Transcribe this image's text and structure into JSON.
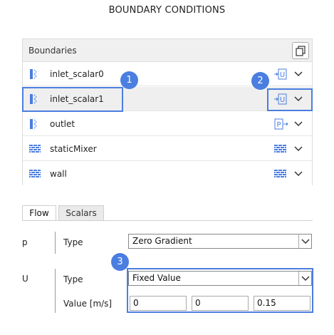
{
  "window": {
    "title": "BOUNDARY CONDITIONS"
  },
  "boundaries": {
    "header": "Boundaries",
    "items": [
      {
        "name": "inlet_scalar0",
        "kind": "patch",
        "type_icon": "U",
        "selected": false
      },
      {
        "name": "inlet_scalar1",
        "kind": "patch",
        "type_icon": "U",
        "selected": true
      },
      {
        "name": "outlet",
        "kind": "patch",
        "type_icon": "P",
        "selected": false
      },
      {
        "name": "staticMixer",
        "kind": "wall",
        "type_icon": "wall",
        "selected": false
      },
      {
        "name": "wall",
        "kind": "wall",
        "type_icon": "wall",
        "selected": false
      }
    ]
  },
  "tabs": [
    {
      "label": "Flow",
      "active": true
    },
    {
      "label": "Scalars",
      "active": false
    }
  ],
  "fields": {
    "p": {
      "name": "p",
      "type_label": "Type",
      "type_value": "Zero Gradient"
    },
    "U": {
      "name": "U",
      "type_label": "Type",
      "type_value": "Fixed Value",
      "value_label": "Value [m/s]",
      "values": [
        "0",
        "0",
        "0.15"
      ]
    }
  },
  "callouts": [
    "1",
    "2",
    "3"
  ],
  "colors": {
    "accent": "#4a7ee0",
    "patch_icon": "#4a7ee0",
    "selected_row": "#efefef"
  }
}
